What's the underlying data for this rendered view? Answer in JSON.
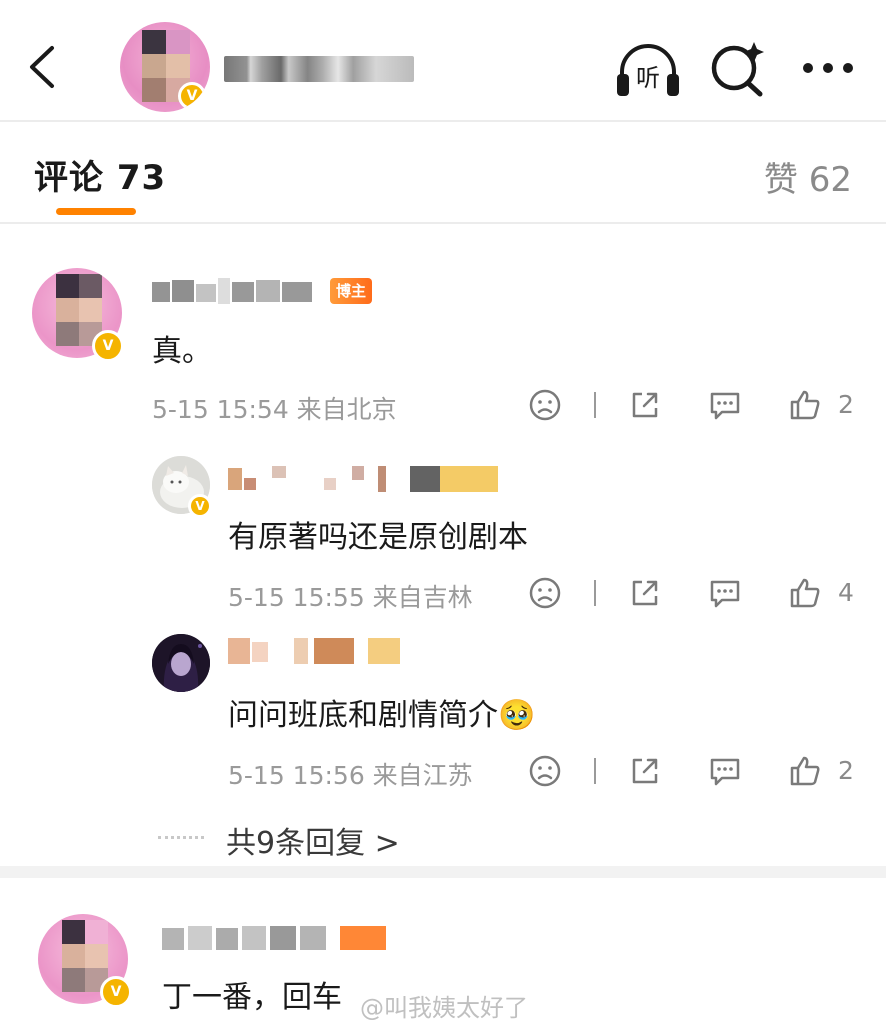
{
  "header": {
    "back": "back-icon",
    "listen_label": "听",
    "search": "search-sparkle-icon",
    "more": "more-icon"
  },
  "tabs": {
    "comments_label": "评论 73",
    "likes_label": "赞 62"
  },
  "comments": [
    {
      "badge": "博主",
      "text": "真。",
      "meta": "5-15 15:54 来自北京",
      "likes": "2"
    },
    {
      "text": "有原著吗还是原创剧本",
      "meta": "5-15 15:55 来自吉林",
      "likes": "4"
    },
    {
      "text": "问问班底和剧情简介🥹",
      "meta": "5-15 15:56 来自江苏",
      "likes": "2"
    },
    {
      "text": "丁一番，回车"
    }
  ],
  "more_replies": "共9条回复 >",
  "watermark": "@叫我姨太好了",
  "colors": {
    "accent": "#ff8200",
    "verified": "#f5b400",
    "meta_text": "#9a9a9a"
  }
}
